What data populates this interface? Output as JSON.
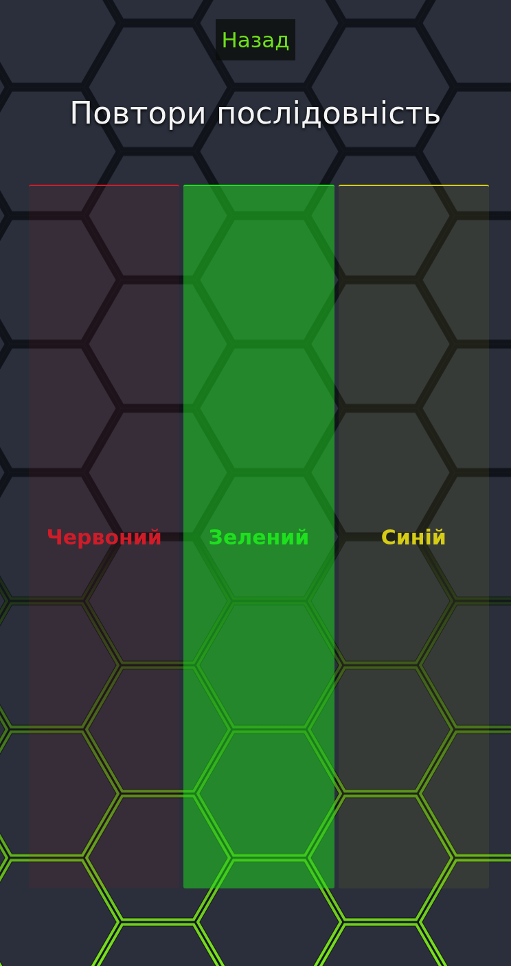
{
  "back_button": {
    "label": "Назад"
  },
  "title": "Повтори послідовність",
  "color_buttons": [
    {
      "label": "Червоний",
      "color": "#d01c28",
      "lit": false
    },
    {
      "label": "Зелений",
      "color": "#1ee01e",
      "lit": true
    },
    {
      "label": "Синій",
      "color": "#d6cc16",
      "lit": false
    }
  ]
}
